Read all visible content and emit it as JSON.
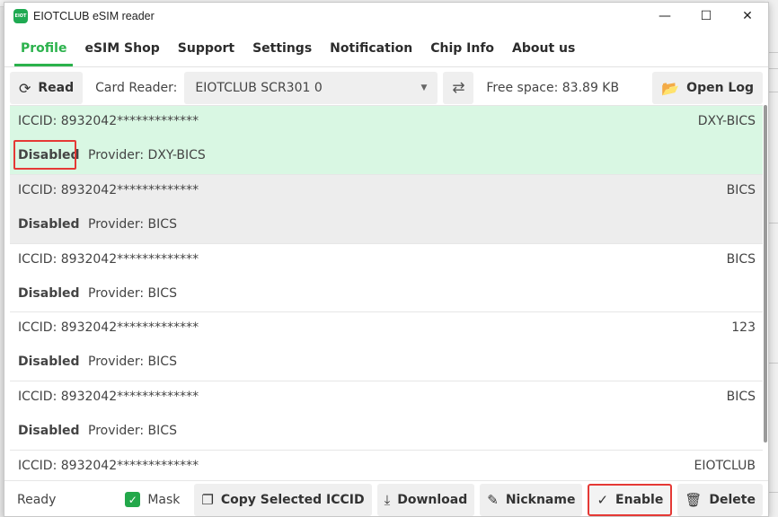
{
  "window": {
    "title": "EIOTCLUB eSIM reader",
    "icon_text": "EIOT",
    "controls": {
      "minimize": "—",
      "maximize": "☐",
      "close": "✕"
    }
  },
  "tabs": [
    {
      "label": "Profile",
      "active": true
    },
    {
      "label": "eSIM Shop",
      "active": false
    },
    {
      "label": "Support",
      "active": false
    },
    {
      "label": "Settings",
      "active": false
    },
    {
      "label": "Notification",
      "active": false
    },
    {
      "label": "Chip Info",
      "active": false
    },
    {
      "label": "About us",
      "active": false
    }
  ],
  "toolbar": {
    "read_label": "Read",
    "card_reader_label": "Card Reader:",
    "card_reader_value": "EIOTCLUB SCR301 0",
    "free_space": "Free space: 83.89 KB",
    "open_log_label": "Open Log"
  },
  "profiles": [
    {
      "iccid": "ICCID: 8932042*************",
      "tag": "DXY-BICS",
      "state": "Disabled",
      "provider": "Provider: DXY-BICS"
    },
    {
      "iccid": "ICCID: 8932042*************",
      "tag": "BICS",
      "state": "Disabled",
      "provider": "Provider: BICS"
    },
    {
      "iccid": "ICCID: 8932042*************",
      "tag": "BICS",
      "state": "Disabled",
      "provider": "Provider: BICS"
    },
    {
      "iccid": "ICCID: 8932042*************",
      "tag": "123",
      "state": "Disabled",
      "provider": "Provider: BICS"
    },
    {
      "iccid": "ICCID: 8932042*************",
      "tag": "BICS",
      "state": "Disabled",
      "provider": "Provider: BICS"
    },
    {
      "iccid": "ICCID: 8932042*************",
      "tag": "EIOTCLUB",
      "state": "",
      "provider": ""
    }
  ],
  "statusbar": {
    "status": "Ready",
    "mask_label": "Mask",
    "mask_checked": true,
    "copy_label": "Copy Selected ICCID",
    "download_label": "Download",
    "nickname_label": "Nickname",
    "enable_label": "Enable",
    "delete_label": "Delete"
  },
  "colors": {
    "accent": "#2bb24c",
    "selected_row": "#d9f7e3",
    "highlight_box": "#e53935"
  }
}
